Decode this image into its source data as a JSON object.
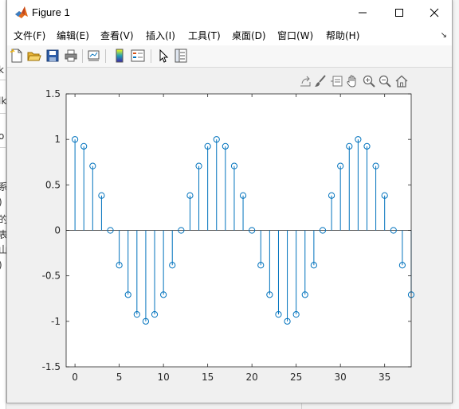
{
  "window": {
    "title": "Figure 1"
  },
  "menubar": {
    "items": [
      {
        "label": "文件(F)",
        "id": "file"
      },
      {
        "label": "编辑(E)",
        "id": "edit"
      },
      {
        "label": "查看(V)",
        "id": "view"
      },
      {
        "label": "插入(I)",
        "id": "insert"
      },
      {
        "label": "工具(T)",
        "id": "tools"
      },
      {
        "label": "桌面(D)",
        "id": "desktop"
      },
      {
        "label": "窗口(W)",
        "id": "window"
      },
      {
        "label": "帮助(H)",
        "id": "help"
      }
    ]
  },
  "toolbar": {
    "buttons": [
      "new-figure-icon",
      "open-file-icon",
      "save-icon",
      "print-icon",
      "link-plot-icon",
      "colorbar-icon",
      "legend-icon",
      "edit-plot-arrow-icon",
      "property-inspector-icon"
    ]
  },
  "axes_toolbar": {
    "buttons": [
      "export-icon",
      "brush-icon",
      "data-tips-icon",
      "pan-hand-icon",
      "zoom-in-icon",
      "zoom-out-icon",
      "home-restore-icon"
    ]
  },
  "background": {
    "fragments": [
      {
        "text": "k",
        "top": 81
      },
      {
        "text": "lk",
        "top": 120
      },
      {
        "text": "o",
        "top": 164
      },
      {
        "text": "系",
        "top": 226
      },
      {
        "text": ")",
        "top": 247
      },
      {
        "text": "的",
        "top": 267
      },
      {
        "text": "表",
        "top": 286
      },
      {
        "text": "山",
        "top": 305
      },
      {
        "text": ")",
        "top": 326
      }
    ]
  },
  "chart_data": {
    "type": "stem",
    "x": [
      0,
      1,
      2,
      3,
      4,
      5,
      6,
      7,
      8,
      9,
      10,
      11,
      12,
      13,
      14,
      15,
      16,
      17,
      18,
      19,
      20,
      21,
      22,
      23,
      24,
      25,
      26,
      27,
      28,
      29,
      30,
      31,
      32,
      33,
      34,
      35,
      36,
      37,
      38
    ],
    "y": [
      1,
      0.9239,
      0.7071,
      0.3827,
      0,
      -0.3827,
      -0.7071,
      -0.9239,
      -1,
      -0.9239,
      -0.7071,
      -0.3827,
      0,
      0.3827,
      0.7071,
      0.9239,
      1,
      0.9239,
      0.7071,
      0.3827,
      0,
      -0.3827,
      -0.7071,
      -0.9239,
      -1,
      -0.9239,
      -0.7071,
      -0.3827,
      0,
      0.3827,
      0.7071,
      0.9239,
      1,
      0.9239,
      0.7071,
      0.3827,
      0,
      -0.3827,
      -0.7071
    ],
    "xlim": [
      -1,
      38
    ],
    "ylim": [
      -1.5,
      1.5
    ],
    "xticks": [
      0,
      5,
      10,
      15,
      20,
      25,
      30,
      35
    ],
    "yticks": [
      -1.5,
      -1,
      -0.5,
      0,
      0.5,
      1,
      1.5
    ],
    "xtick_labels": [
      "0",
      "5",
      "10",
      "15",
      "20",
      "25",
      "30",
      "35"
    ],
    "ytick_labels": [
      "-1.5",
      "-1",
      "-0.5",
      "0",
      "0.5",
      "1",
      "1.5"
    ],
    "title": "",
    "xlabel": "",
    "ylabel": "",
    "grid": false,
    "color": "#0072bd"
  }
}
